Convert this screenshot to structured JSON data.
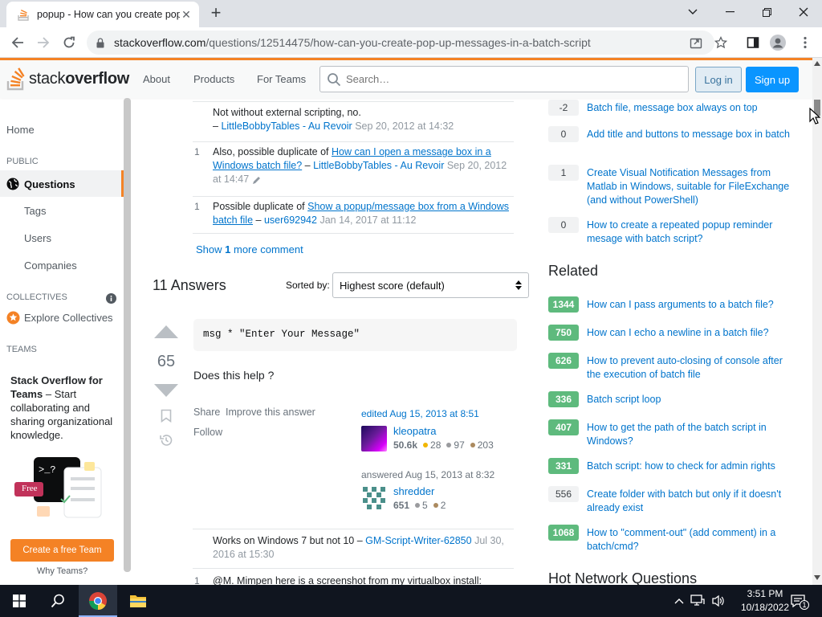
{
  "browser": {
    "tab_title": "popup - How can you create pop-up messages in a batch script",
    "url_host": "stackoverflow.com",
    "url_path": "/questions/12514475/how-can-you-create-pop-up-messages-in-a-batch-script"
  },
  "header": {
    "logo_text_plain": "stack",
    "logo_text_bold": "overflow",
    "nav": [
      "About",
      "Products",
      "For Teams"
    ],
    "search_placeholder": "Search…",
    "login": "Log in",
    "signup": "Sign up"
  },
  "sidebar": {
    "home": "Home",
    "public_label": "PUBLIC",
    "questions": "Questions",
    "tags": "Tags",
    "users": "Users",
    "companies": "Companies",
    "collectives_label": "COLLECTIVES",
    "explore_collectives": "Explore Collectives",
    "teams_label": "TEAMS",
    "teams_title_bold": "Stack Overflow for Teams",
    "teams_title_rest": " – Start collaborating and sharing organizational knowledge.",
    "free_badge": "Free",
    "create_team": "Create a free Team",
    "why_teams": "Why Teams?"
  },
  "comments": [
    {
      "score": "",
      "text": "Not without external scripting, no.",
      "dash": "– ",
      "user": "LittleBobbyTables - Au Revoir",
      "time": "Sep 20, 2012 at 14:32"
    },
    {
      "score": "1",
      "prefix": "Also, possible duplicate of ",
      "link": "How can I open a message box in a Windows batch file?",
      "dash": " – ",
      "user": "LittleBobbyTables - Au Revoir",
      "time": "Sep 20, 2012 at 14:47"
    },
    {
      "score": "1",
      "prefix": "Possible duplicate of ",
      "link": "Show a popup/message box from a Windows batch file",
      "dash": " – ",
      "user": "user692942",
      "time": "Jan 14, 2017 at 11:12"
    }
  ],
  "show_more": {
    "prefix": "Show ",
    "count": "1",
    "suffix": " more comment"
  },
  "answers": {
    "heading": "11 Answers",
    "sorted_by": "Sorted by:",
    "sort_value": "Highest score (default)"
  },
  "answer": {
    "score": "65",
    "code": "msg * \"Enter Your Message\"",
    "text": "Does this help ?",
    "share": "Share",
    "improve": "Improve this answer",
    "follow": "Follow",
    "edited_label": "edited Aug 15, 2013 at 8:51",
    "editor_name": "kleopatra",
    "editor_rep": "50.6k",
    "editor_gold": "28",
    "editor_silver": "97",
    "editor_bronze": "203",
    "answered_label": "answered Aug 15, 2013 at 8:32",
    "author_name": "shredder",
    "author_rep": "651",
    "author_silver": "5",
    "author_bronze": "2"
  },
  "answer_comments": [
    {
      "score": "",
      "text": "Works on Windows 7 but not 10",
      "dash": " – ",
      "user": "GM-Script-Writer-62850",
      "time": "Jul 30, 2016 at 15:30"
    },
    {
      "score": "1",
      "text": "@M. Mimpen here is a screenshot from my virtualbox install:"
    }
  ],
  "linked": [
    {
      "score": "-2",
      "title": "Batch file, message box always on top"
    },
    {
      "score": "0",
      "title": "Add title and buttons to message box in batch"
    },
    {
      "score": "1",
      "title": "Create Visual Notification Messages from Matlab in Windows, suitable for FileExchange (and without PowerShell)"
    },
    {
      "score": "0",
      "title": "How to create a repeated popup reminder mesage with batch script?"
    }
  ],
  "related_heading": "Related",
  "related": [
    {
      "score": "1344",
      "title": "How can I pass arguments to a batch file?"
    },
    {
      "score": "750",
      "title": "How can I echo a newline in a batch file?"
    },
    {
      "score": "626",
      "title": "How to prevent auto-closing of console after the execution of batch file"
    },
    {
      "score": "336",
      "title": "Batch script loop"
    },
    {
      "score": "407",
      "title": "How to get the path of the batch script in Windows?"
    },
    {
      "score": "331",
      "title": "Batch script: how to check for admin rights"
    },
    {
      "score": "556",
      "title": "Create folder with batch but only if it doesn't already exist"
    },
    {
      "score": "1068",
      "title": "How to \"comment-out\" (add comment) in a batch/cmd?"
    }
  ],
  "hot_network_heading": "Hot Network Questions",
  "taskbar": {
    "time": "3:51 PM",
    "date": "10/18/2022",
    "notif_count": "1"
  },
  "colors": {
    "accent": "#f48225",
    "link": "#0074cc",
    "green": "#5eba7d",
    "signup": "#0a95ff"
  }
}
